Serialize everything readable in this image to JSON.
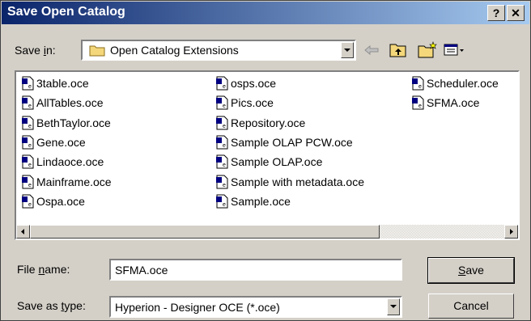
{
  "window": {
    "title": "Save Open Catalog",
    "help_label": "?",
    "close_label": "✕"
  },
  "toolbar": {
    "save_in_prefix": "Save ",
    "save_in_hotkey": "i",
    "save_in_suffix": "n:",
    "current_folder": "Open Catalog Extensions",
    "folder_icon": "folder-icon",
    "tools": [
      "back-arrow-icon",
      "up-folder-icon",
      "new-folder-icon",
      "view-menu-icon"
    ]
  },
  "files": {
    "col1": [
      "3table.oce",
      "AllTables.oce",
      "BethTaylor.oce",
      "Gene.oce",
      "Lindaoce.oce",
      "Mainframe.oce",
      "Ospa.oce"
    ],
    "col2": [
      "osps.oce",
      "Pics.oce",
      "Repository.oce",
      "Sample OLAP PCW.oce",
      "Sample OLAP.oce",
      "Sample with metadata.oce",
      "Sample.oce"
    ],
    "col3": [
      "Scheduler.oce",
      "SFMA.oce"
    ]
  },
  "filename": {
    "prefix": "File ",
    "hotkey": "n",
    "suffix": "ame:",
    "value": "SFMA.oce"
  },
  "filetype": {
    "prefix": "Save as ",
    "hotkey": "t",
    "suffix": "ype:",
    "value": "Hyperion - Designer OCE (*.oce)"
  },
  "buttons": {
    "save_hotkey": "S",
    "save_rest": "ave",
    "cancel": "Cancel"
  }
}
